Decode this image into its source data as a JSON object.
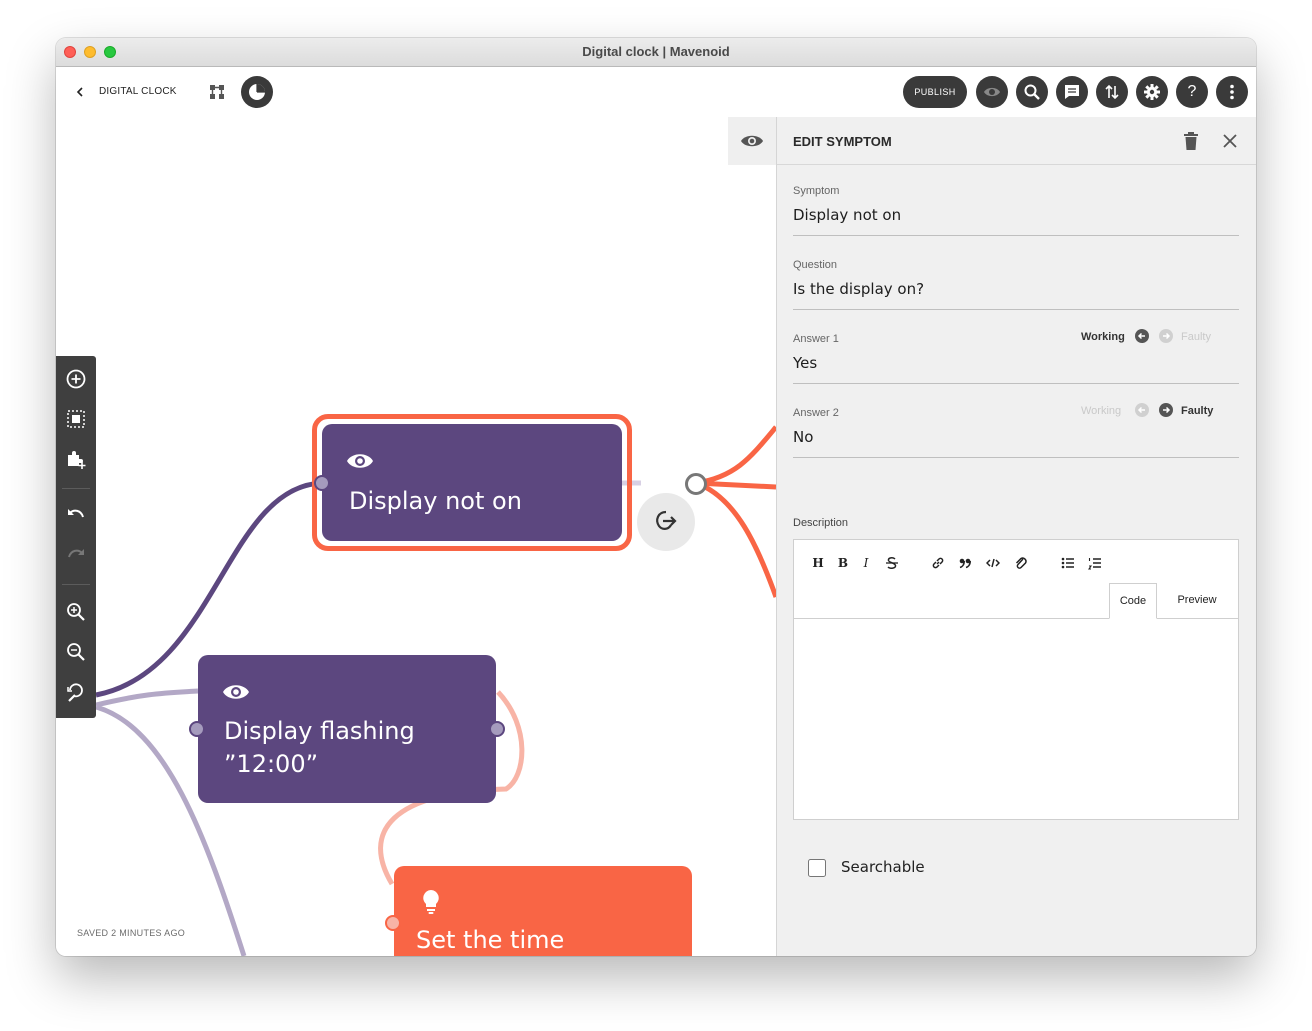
{
  "window": {
    "title": "Digital clock | Mavenoid"
  },
  "header": {
    "breadcrumb": "DIGITAL CLOCK",
    "publish_label": "PUBLISH",
    "help_glyph": "?",
    "icons": [
      "chevron-left-icon",
      "hierarchy-icon",
      "pie-chart-icon",
      "eye-icon",
      "search-icon",
      "comment-icon",
      "sort-icon",
      "gear-icon",
      "help-icon",
      "more-vertical-icon"
    ]
  },
  "canvas": {
    "tools": [
      "add-circle-icon",
      "select-area-icon",
      "puzzle-add-icon",
      "undo-icon",
      "redo-icon",
      "zoom-in-icon",
      "zoom-out-icon",
      "zoom-fit-icon"
    ],
    "nodes": [
      {
        "label": "Display not on",
        "kind": "symptom",
        "selected": true
      },
      {
        "label": "Display flashing ”12:00”",
        "kind": "symptom",
        "selected": false
      },
      {
        "label": "Set the time",
        "kind": "solution",
        "selected": false
      }
    ],
    "saved_status": "SAVED 2 MINUTES AGO",
    "colors": {
      "symptom": "#5c477f",
      "solution": "#f96545",
      "selected_ring": "#f96545",
      "link_purple": "#5c477f",
      "link_lavender": "#b3a8c6",
      "link_pink": "#f8b4a6"
    }
  },
  "panel": {
    "title": "EDIT SYMPTOM",
    "symptom": {
      "label": "Symptom",
      "value": "Display not on"
    },
    "question": {
      "label": "Question",
      "value": "Is the display on?"
    },
    "answers": [
      {
        "label": "Answer 1",
        "value": "Yes",
        "working": "Working",
        "faulty": "Faulty",
        "selected": "Working"
      },
      {
        "label": "Answer 2",
        "value": "No",
        "working": "Working",
        "faulty": "Faulty",
        "selected": "Faulty"
      }
    ],
    "description": {
      "label": "Description",
      "toolbar": [
        "H",
        "B",
        "I",
        "strikethrough",
        "link",
        "quote",
        "code",
        "attachment",
        "bulleted-list",
        "numbered-list"
      ],
      "tabs": [
        "Code",
        "Preview"
      ],
      "active_tab": "Code",
      "value": ""
    },
    "searchable": {
      "label": "Searchable",
      "checked": false
    }
  }
}
